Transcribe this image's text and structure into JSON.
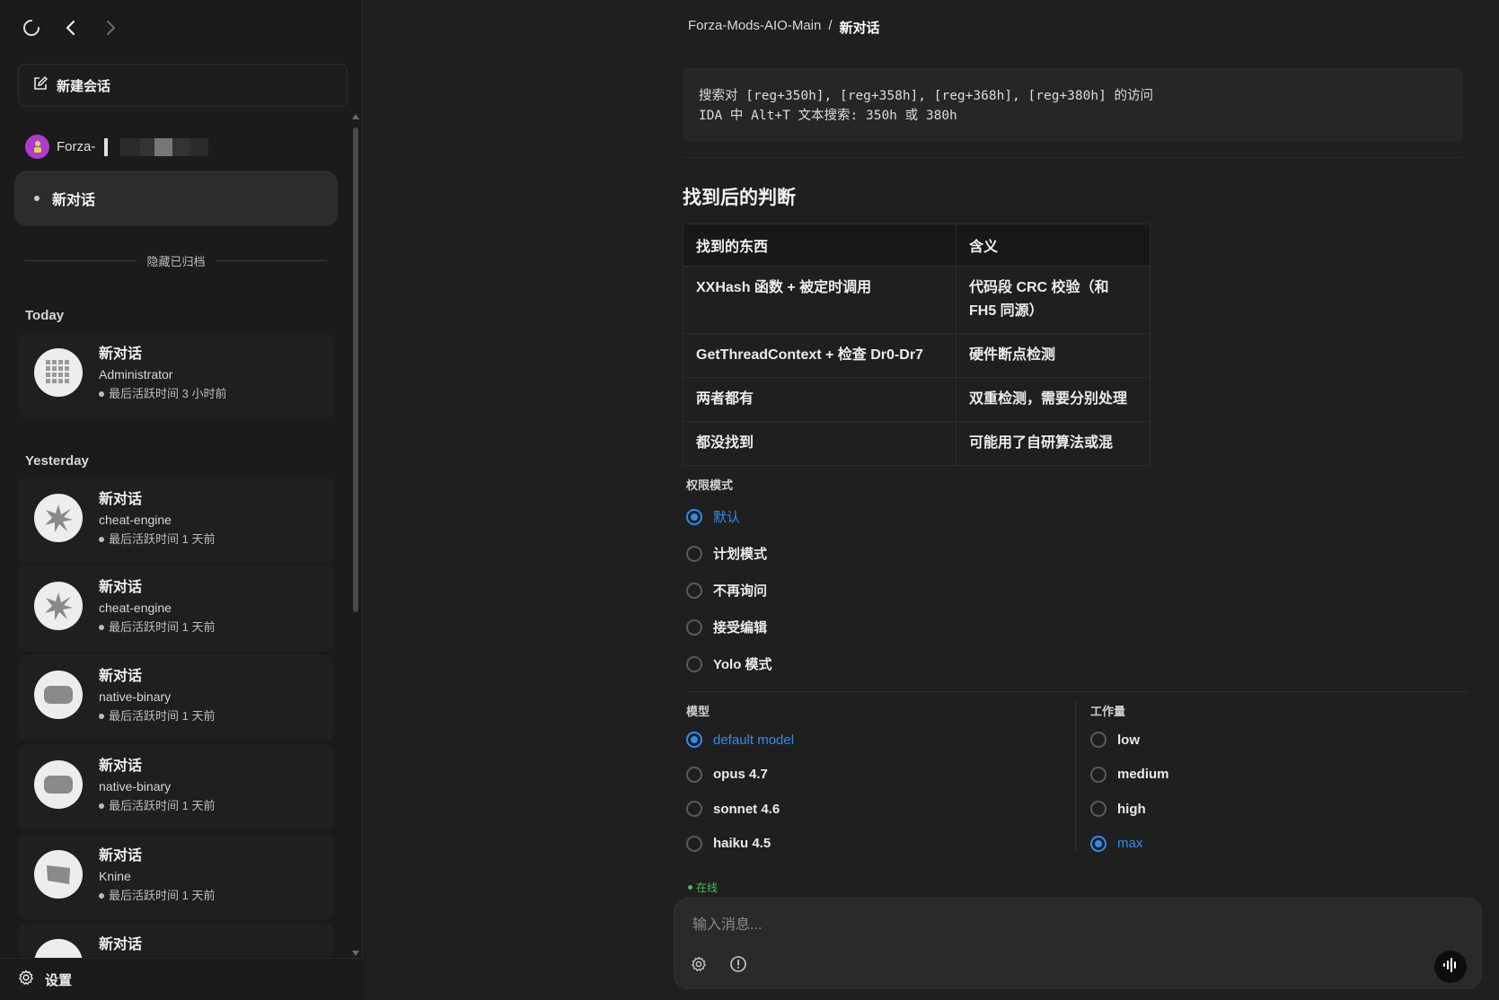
{
  "sidebar": {
    "new_chat_label": "新建会话",
    "project_name": "Forza-",
    "active_chat_label": "新对话",
    "archive_toggle": "隐藏已归档",
    "sections": {
      "today": "Today",
      "yesterday": "Yesterday"
    },
    "today_items": [
      {
        "title": "新对话",
        "sub": "Administrator",
        "meta": "最后活跃时间 3 小时前",
        "icon": "grid-icon"
      }
    ],
    "yesterday_items": [
      {
        "title": "新对话",
        "sub": "cheat-engine",
        "meta": "最后活跃时间 1 天前",
        "icon": "starburst-icon"
      },
      {
        "title": "新对话",
        "sub": "cheat-engine",
        "meta": "最后活跃时间 1 天前",
        "icon": "starburst-icon"
      },
      {
        "title": "新对话",
        "sub": "native-binary",
        "meta": "最后活跃时间 1 天前",
        "icon": "pill-icon"
      },
      {
        "title": "新对话",
        "sub": "native-binary",
        "meta": "最后活跃时间 1 天前",
        "icon": "pill-icon"
      },
      {
        "title": "新对话",
        "sub": "Knine",
        "meta": "最后活跃时间 1 天前",
        "icon": "tag-icon"
      },
      {
        "title": "新对话",
        "sub": "",
        "meta": "",
        "icon": ""
      }
    ],
    "settings_label": "设置"
  },
  "main": {
    "breadcrumb": {
      "project": "Forza-Mods-AIO-Main",
      "sep": "/",
      "current": "新对话"
    },
    "code_lines": "搜索对 [reg+350h], [reg+358h], [reg+368h], [reg+380h] 的访问\nIDA 中 Alt+T 文本搜索: 350h 或 380h",
    "heading": "找到后的判断",
    "table": {
      "headers": [
        "找到的东西",
        "含义"
      ],
      "rows": [
        [
          "XXHash 函数 + 被定时调用",
          "代码段 CRC 校验（和 FH5 同源）"
        ],
        [
          "GetThreadContext + 检查 Dr0-Dr7",
          "硬件断点检测"
        ],
        [
          "两者都有",
          "双重检测，需要分别处理"
        ],
        [
          "都没找到",
          "可能用了自研算法或混"
        ]
      ]
    }
  },
  "options": {
    "permission_label": "权限模式",
    "permission_modes": [
      "默认",
      "计划模式",
      "不再询问",
      "接受编辑",
      "Yolo 模式"
    ],
    "permission_selected": "默认",
    "model_label": "模型",
    "models": [
      "default model",
      "opus 4.7",
      "sonnet 4.6",
      "haiku 4.5"
    ],
    "model_selected": "default model",
    "effort_label": "工作量",
    "efforts": [
      "low",
      "medium",
      "high",
      "max"
    ],
    "effort_selected": "max"
  },
  "status": {
    "online": "在线"
  },
  "composer": {
    "placeholder": "输入消息..."
  },
  "colors": {
    "accent": "#2f8cf0",
    "online": "#3fbf5a",
    "project_avatar": "#b03ad0"
  }
}
